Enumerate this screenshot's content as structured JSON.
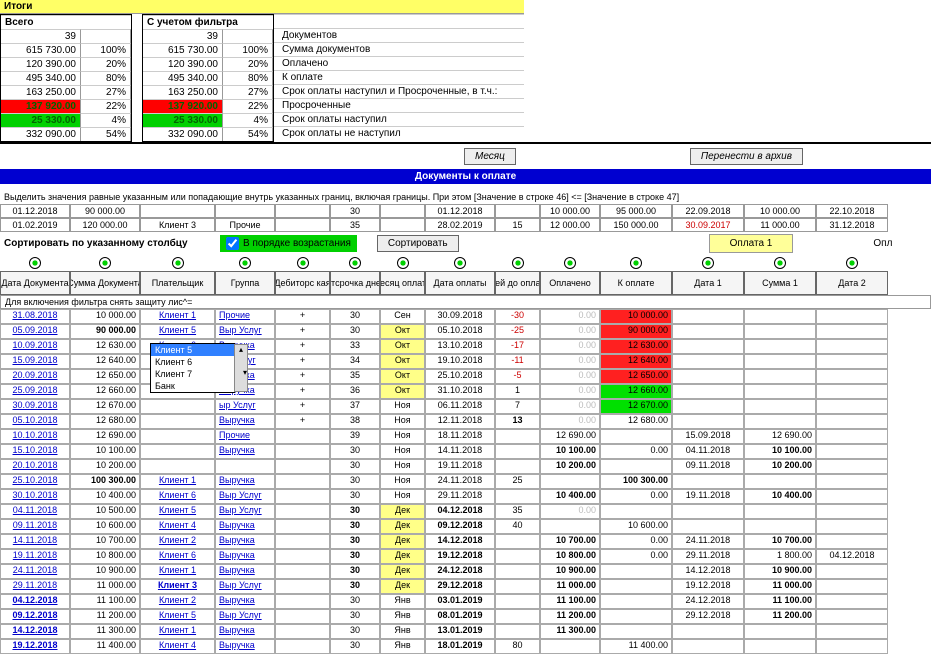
{
  "totals": {
    "title": "Итоги",
    "left_label": "Всего",
    "right_label": "С учетом фильтра",
    "left_count": "39",
    "right_count": "39",
    "rows": [
      {
        "l_amt": "615 730.00",
        "l_pct": "100%",
        "r_amt": "615 730.00",
        "r_pct": "100%",
        "desc": "Документов",
        "above": "Сумма документов"
      },
      {
        "l_amt": "120 390.00",
        "l_pct": "20%",
        "r_amt": "120 390.00",
        "r_pct": "20%",
        "desc": "Оплачено"
      },
      {
        "l_amt": "495 340.00",
        "l_pct": "80%",
        "r_amt": "495 340.00",
        "r_pct": "80%",
        "desc": "К оплате"
      },
      {
        "l_amt": "163 250.00",
        "l_pct": "27%",
        "r_amt": "163 250.00",
        "r_pct": "27%",
        "desc": "Срок оплаты наступил и Просроченные, в т.ч.:"
      },
      {
        "l_amt": "137 920.00",
        "l_pct": "22%",
        "r_amt": "137 920.00",
        "r_pct": "22%",
        "desc": "  Просроченные",
        "hl": "red"
      },
      {
        "l_amt": "25 330.00",
        "l_pct": "4%",
        "r_amt": "25 330.00",
        "r_pct": "4%",
        "desc": "  Срок оплаты наступил",
        "hl": "green"
      },
      {
        "l_amt": "332 090.00",
        "l_pct": "54%",
        "r_amt": "332 090.00",
        "r_pct": "54%",
        "desc": "Срок оплаты не наступил"
      }
    ]
  },
  "buttons": {
    "month": "Месяц",
    "archive": "Перенести в архив",
    "sort": "Сортировать"
  },
  "bar_title": "Документы к оплате",
  "filter_note": "Выделить значения равные указанным или попадающие внутрь указанных границ, включая границы. При этом [Значение в строке 46] <= [Значение в строке 47]",
  "filter_rows": [
    {
      "c0": "01.12.2018",
      "c1": "90 000.00",
      "c2": "",
      "c3": "",
      "c4": "",
      "c5": "30",
      "c6": "",
      "c7": "01.12.2018",
      "c8": "",
      "c9": "10 000.00",
      "c10": "95 000.00",
      "c11": "22.09.2018",
      "c12": "10 000.00",
      "c13": "22.10.2018"
    },
    {
      "c0": "01.02.2019",
      "c1": "120 000.00",
      "c2": "Клиент 3",
      "c3": "Прочие",
      "c4": "",
      "c5": "35",
      "c6": "",
      "c7": "28.02.2019",
      "c8": "15",
      "c9": "12 000.00",
      "c10": "150 000.00",
      "c11": "30.09.2017",
      "c12": "11 000.00",
      "c13": "31.12.2018"
    }
  ],
  "sort_label": "Сортировать по указанному столбцу",
  "asc_label": "В порядке возрастания",
  "pay1_label": "Оплата 1",
  "pay_right": "Опл",
  "headers": [
    "Дата Документа",
    "Сумма Документа",
    "Плательщик",
    "Группа",
    "Дебиторс кая",
    "Отсрочка дней",
    "Месяц оплаты",
    "Дата оплаты",
    "Дней до оплаты",
    "Оплачено",
    "К оплате",
    "Дата 1",
    "Сумма 1",
    "Дата 2"
  ],
  "sub_note": "Для включения фильтра снять защиту лис^=",
  "dropdown": [
    "Выручка",
    "ыр Услуг",
    "Выручка",
    "ыр Услуг",
    "Выручка",
    "Выручка",
    "ыр Услуг",
    "Выручка",
    "Прочие",
    "Выручка"
  ],
  "dd_list": [
    "Клиент 5",
    "Клиент 6",
    "Клиент 7",
    "Банк"
  ],
  "rows": [
    {
      "d": "31.08.2018",
      "s": "10 000.00",
      "p": "Клиент 1",
      "g": "Прочие",
      "db": "+",
      "dl": "30",
      "m": "Сен",
      "pd": "30.09.2018",
      "dd": "-30",
      "op": "0.00",
      "du": "10 000.00",
      "ddc": "red",
      "duc": "red"
    },
    {
      "d": "05.09.2018",
      "s": "90 000.00",
      "sb": true,
      "p": "Клиент 5",
      "g": "Выр Услуг",
      "db": "+",
      "dl": "30",
      "m": "Окт",
      "my": true,
      "pd": "05.10.2018",
      "dd": "-25",
      "op": "0.00",
      "du": "90 000.00",
      "ddc": "red",
      "duc": "red"
    },
    {
      "d": "10.09.2018",
      "s": "12 630.00",
      "p": "Клиент 6",
      "g": "Выручка",
      "db": "+",
      "dl": "33",
      "m": "Окт",
      "my": true,
      "pd": "13.10.2018",
      "dd": "-17",
      "op": "0.00",
      "du": "12 630.00",
      "ddc": "red",
      "duc": "red"
    },
    {
      "d": "15.09.2018",
      "s": "12 640.00",
      "p": "Клиент 5",
      "g": "",
      "db": "+",
      "dl": "34",
      "m": "Окт",
      "my": true,
      "pd": "19.10.2018",
      "dd": "-11",
      "op": "0.00",
      "du": "12 640.00",
      "ddc": "red",
      "duc": "red"
    },
    {
      "d": "20.09.2018",
      "s": "12 650.00",
      "p": "",
      "g": "",
      "db": "+",
      "dl": "35",
      "m": "Окт",
      "my": true,
      "pd": "25.10.2018",
      "dd": "-5",
      "op": "0.00",
      "du": "12 650.00",
      "ddc": "red",
      "duc": "red"
    },
    {
      "d": "25.09.2018",
      "s": "12 660.00",
      "p": "",
      "g": "",
      "db": "+",
      "dl": "36",
      "m": "Окт",
      "my": true,
      "pd": "31.10.2018",
      "dd": "1",
      "op": "0.00",
      "du": "12 660.00",
      "duc": "grn"
    },
    {
      "d": "30.09.2018",
      "s": "12 670.00",
      "p": "",
      "g": "",
      "db": "+",
      "dl": "37",
      "m": "Ноя",
      "pd": "06.11.2018",
      "dd": "7",
      "op": "0.00",
      "du": "12 670.00",
      "duc": "grn"
    },
    {
      "d": "05.10.2018",
      "s": "12 680.00",
      "p": "",
      "g": "",
      "db": "+",
      "dl": "38",
      "m": "Ноя",
      "pd": "12.11.2018",
      "dd": "13",
      "ddb": true,
      "op": "0.00",
      "du": "12 680.00"
    },
    {
      "d": "10.10.2018",
      "s": "12 690.00",
      "p": "",
      "g": "",
      "db": "",
      "dl": "39",
      "m": "Ноя",
      "pd": "18.11.2018",
      "dd": "",
      "op": "12 690.00",
      "du": "",
      "d1": "15.09.2018",
      "s1": "12 690.00"
    },
    {
      "d": "15.10.2018",
      "s": "10 100.00",
      "p": "",
      "g": "",
      "db": "",
      "dl": "30",
      "m": "Ноя",
      "pd": "14.11.2018",
      "dd": "",
      "op": "10 100.00",
      "opb": true,
      "du": "0.00",
      "d1": "04.11.2018",
      "s1": "10 100.00",
      "s1b": true
    },
    {
      "d": "20.10.2018",
      "s": "10 200.00",
      "p": "",
      "g": "",
      "db": "",
      "dl": "30",
      "m": "Ноя",
      "pd": "19.11.2018",
      "dd": "",
      "op": "10 200.00",
      "opb": true,
      "du": "",
      "d1": "09.11.2018",
      "s1": "10 200.00",
      "s1b": true
    },
    {
      "d": "25.10.2018",
      "s": "100 300.00",
      "sb": true,
      "p": "Клиент 1",
      "g": "Выручка",
      "db": "",
      "dl": "30",
      "m": "Ноя",
      "pd": "24.11.2018",
      "dd": "25",
      "op": "",
      "du": "100 300.00",
      "dub": true
    },
    {
      "d": "30.10.2018",
      "s": "10 400.00",
      "p": "Клиент 6",
      "g": "Выр Услуг",
      "db": "",
      "dl": "30",
      "m": "Ноя",
      "pd": "29.11.2018",
      "dd": "",
      "op": "10 400.00",
      "opb": true,
      "du": "0.00",
      "d1": "19.11.2018",
      "s1": "10 400.00",
      "s1b": true
    },
    {
      "d": "04.11.2018",
      "s": "10 500.00",
      "p": "Клиент 5",
      "g": "Выр Услуг",
      "db": "",
      "dl": "30",
      "dlb": true,
      "m": "Дек",
      "my": true,
      "pd": "04.12.2018",
      "pdb": true,
      "dd": "35",
      "op": "0.00",
      "du": "",
      "dub": true
    },
    {
      "d": "09.11.2018",
      "s": "10 600.00",
      "p": "Клиент 4",
      "g": "Выручка",
      "db": "",
      "dl": "30",
      "dlb": true,
      "m": "Дек",
      "my": true,
      "pd": "09.12.2018",
      "pdb": true,
      "dd": "40",
      "op": "",
      "du": "10 600.00"
    },
    {
      "d": "14.11.2018",
      "s": "10 700.00",
      "p": "Клиент 2",
      "g": "Выручка",
      "db": "",
      "dl": "30",
      "dlb": true,
      "m": "Дек",
      "my": true,
      "pd": "14.12.2018",
      "pdb": true,
      "dd": "",
      "op": "10 700.00",
      "opb": true,
      "du": "0.00",
      "d1": "24.11.2018",
      "s1": "10 700.00",
      "s1b": true
    },
    {
      "d": "19.11.2018",
      "s": "10 800.00",
      "p": "Клиент 6",
      "g": "Выручка",
      "db": "",
      "dl": "30",
      "dlb": true,
      "m": "Дек",
      "my": true,
      "pd": "19.12.2018",
      "pdb": true,
      "dd": "",
      "op": "10 800.00",
      "opb": true,
      "du": "0.00",
      "d1": "29.11.2018",
      "s1": "1 800.00",
      "d2": "04.12.2018"
    },
    {
      "d": "24.11.2018",
      "s": "10 900.00",
      "p": "Клиент 1",
      "g": "Выручка",
      "db": "",
      "dl": "30",
      "dlb": true,
      "m": "Дек",
      "my": true,
      "pd": "24.12.2018",
      "pdb": true,
      "dd": "",
      "op": "10 900.00",
      "opb": true,
      "du": "",
      "d1": "14.12.2018",
      "s1": "10 900.00",
      "s1b": true
    },
    {
      "d": "29.11.2018",
      "s": "11 000.00",
      "p": "Клиент 3",
      "pb": true,
      "g": "Выр Услуг",
      "db": "",
      "dl": "30",
      "dlb": true,
      "m": "Дек",
      "my": true,
      "pd": "29.12.2018",
      "pdb": true,
      "dd": "",
      "op": "11 000.00",
      "opb": true,
      "du": "",
      "d1": "19.12.2018",
      "s1": "11 000.00",
      "s1b": true
    },
    {
      "d": "04.12.2018",
      "db_": true,
      "s": "11 100.00",
      "p": "Клиент 2",
      "g": "Выручка",
      "db": "",
      "dl": "30",
      "m": "Янв",
      "pd": "03.01.2019",
      "pdb": true,
      "dd": "",
      "op": "11 100.00",
      "opb": true,
      "du": "",
      "d1": "24.12.2018",
      "s1": "11 100.00",
      "s1b": true
    },
    {
      "d": "09.12.2018",
      "db_": true,
      "s": "11 200.00",
      "p": "Клиент 5",
      "g": "Выр Услуг",
      "db": "",
      "dl": "30",
      "m": "Янв",
      "pd": "08.01.2019",
      "pdb": true,
      "dd": "",
      "op": "11 200.00",
      "opb": true,
      "du": "",
      "d1": "29.12.2018",
      "s1": "11 200.00",
      "s1b": true
    },
    {
      "d": "14.12.2018",
      "db_": true,
      "s": "11 300.00",
      "p": "Клиент 1",
      "g": "Выручка",
      "db": "",
      "dl": "30",
      "m": "Янв",
      "pd": "13.01.2019",
      "pdb": true,
      "dd": "",
      "op": "11 300.00",
      "opb": true,
      "du": "",
      "d1": "",
      "s1": ""
    },
    {
      "d": "19.12.2018",
      "db_": true,
      "s": "11 400.00",
      "p": "Клиент 4",
      "g": "Выручка",
      "db": "",
      "dl": "30",
      "m": "Янв",
      "pd": "18.01.2019",
      "pdb": true,
      "dd": "80",
      "op": "",
      "du": "11 400.00",
      "opb": true,
      "d1": "",
      "s1": ""
    }
  ]
}
